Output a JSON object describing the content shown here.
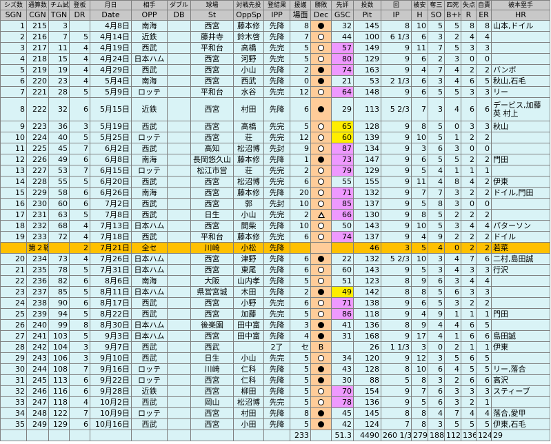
{
  "header1": [
    "シズ数",
    "通算数",
    "チム試",
    "登板",
    "月日",
    "相手",
    "ダブル",
    "球場",
    "対戦先投",
    "登結果",
    "援護",
    "勝敗",
    "先評",
    "投数",
    "回",
    "被安",
    "奪三",
    "四死",
    "失点",
    "自責",
    "被本塁手"
  ],
  "header2": [
    "SGN",
    "CGN",
    "TGN",
    "DR",
    "Date",
    "OPP",
    "DB",
    "St",
    "OppSp",
    "IPP",
    "場面",
    "Dec",
    "GSC",
    "Pit",
    "IP",
    "H",
    "SO",
    "B+H",
    "R",
    "ER",
    "HR"
  ],
  "rows": [
    {
      "sgn": "1",
      "cgn": "215",
      "tgn": "3",
      "dr": "",
      "date": "4月8日",
      "opp": "南海",
      "db": "",
      "st": "西宮",
      "sp": "藤本修",
      "ipp": "先降",
      "sc": "8",
      "dec": "win",
      "gsc": "32",
      "gc": "",
      "pit": "145",
      "ip": "8",
      "h": "10",
      "so": "5",
      "bh": "5",
      "r": "8",
      "er": "8",
      "hr": "山本,ドイル"
    },
    {
      "sgn": "2",
      "cgn": "216",
      "tgn": "7",
      "dr": "5",
      "date": "4月14日",
      "opp": "近鉄",
      "db": "",
      "st": "藤井寺",
      "sp": "鈴木啓",
      "ipp": "先降",
      "sc": "7",
      "dec": "loss",
      "gsc": "44",
      "gc": "",
      "pit": "100",
      "ip": "6 1/3",
      "h": "6",
      "so": "3",
      "bh": "2",
      "r": "4",
      "er": "4",
      "hr": ""
    },
    {
      "sgn": "3",
      "cgn": "217",
      "tgn": "11",
      "dr": "4",
      "date": "4月19日",
      "opp": "西武",
      "db": "",
      "st": "平和台",
      "sp": "高橋",
      "ipp": "先完",
      "sc": "5",
      "dec": "loss",
      "gsc": "57",
      "gc": "pink",
      "pit": "149",
      "ip": "9",
      "h": "11",
      "so": "7",
      "bh": "5",
      "r": "3",
      "er": "3",
      "hr": ""
    },
    {
      "sgn": "4",
      "cgn": "218",
      "tgn": "15",
      "dr": "4",
      "date": "4月24日",
      "opp": "日本ハム",
      "db": "",
      "st": "西宮",
      "sp": "河野",
      "ipp": "先完",
      "sc": "5",
      "dec": "loss",
      "gsc": "80",
      "gc": "pink",
      "pit": "129",
      "ip": "9",
      "h": "6",
      "so": "2",
      "bh": "3",
      "r": "0",
      "er": "0",
      "hr": ""
    },
    {
      "sgn": "5",
      "cgn": "219",
      "tgn": "19",
      "dr": "4",
      "date": "4月29日",
      "opp": "西武",
      "db": "",
      "st": "西宮",
      "sp": "小山",
      "ipp": "先降",
      "sc": "2",
      "dec": "win",
      "gsc": "74",
      "gc": "pink",
      "pit": "163",
      "ip": "9",
      "h": "4",
      "so": "7",
      "bh": "4",
      "r": "2",
      "er": "2",
      "hr": "バンボ"
    },
    {
      "sgn": "6",
      "cgn": "220",
      "tgn": "23",
      "dr": "4",
      "date": "5月4日",
      "opp": "南海",
      "db": "",
      "st": "西宮",
      "sp": "西武",
      "ipp": "先降",
      "sc": "0",
      "dec": "win",
      "gsc": "21",
      "gc": "",
      "pit": "53",
      "ip": "2 1/3",
      "h": "6",
      "so": "3",
      "bh": "4",
      "r": "6",
      "er": "5",
      "hr": "秋山,石毛"
    },
    {
      "sgn": "7",
      "cgn": "221",
      "tgn": "28",
      "dr": "5",
      "date": "5月9日",
      "opp": "ロッテ",
      "db": "",
      "st": "平和台",
      "sp": "水谷",
      "ipp": "先完",
      "sc": "12",
      "dec": "loss",
      "gsc": "64",
      "gc": "pink",
      "pit": "148",
      "ip": "9",
      "h": "6",
      "so": "5",
      "bh": "5",
      "r": "3",
      "er": "3",
      "hr": "リー"
    },
    {
      "sgn": "8",
      "cgn": "222",
      "tgn": "32",
      "dr": "6",
      "date": "5月15日",
      "opp": "近鉄",
      "db": "",
      "st": "西宮",
      "sp": "村田",
      "ipp": "先降",
      "sc": "6",
      "dec": "win",
      "gsc": "29",
      "gc": "",
      "pit": "113",
      "ip": "5 2/3",
      "h": "7",
      "so": "3",
      "bh": "4",
      "r": "6",
      "er": "6",
      "hr": "デービス,加藤英 村上",
      "tall": true
    },
    {
      "sgn": "9",
      "cgn": "223",
      "tgn": "36",
      "dr": "3",
      "date": "5月19日",
      "opp": "西武",
      "db": "",
      "st": "西宮",
      "sp": "高橋",
      "ipp": "先完",
      "sc": "5",
      "dec": "loss",
      "gsc": "65",
      "gc": "yel",
      "pit": "128",
      "ip": "9",
      "h": "8",
      "so": "5",
      "bh": "0",
      "r": "3",
      "er": "3",
      "hr": "秋山"
    },
    {
      "sgn": "10",
      "cgn": "224",
      "tgn": "40",
      "dr": "5",
      "date": "5月25日",
      "opp": "ロッテ",
      "db": "",
      "st": "西宮",
      "sp": "荘",
      "ipp": "先完",
      "sc": "12",
      "dec": "loss",
      "gsc": "60",
      "gc": "yel",
      "pit": "139",
      "ip": "9",
      "h": "10",
      "so": "5",
      "bh": "1",
      "r": "2",
      "er": "2",
      "hr": ""
    },
    {
      "sgn": "11",
      "cgn": "225",
      "tgn": "45",
      "dr": "7",
      "date": "6月2日",
      "opp": "西武",
      "db": "",
      "st": "高知",
      "sp": "松沼博",
      "ipp": "先封",
      "sc": "9",
      "dec": "loss",
      "gsc": "87",
      "gc": "pink",
      "pit": "134",
      "ip": "9",
      "h": "3",
      "so": "6",
      "bh": "3",
      "r": "0",
      "er": "0",
      "hr": ""
    },
    {
      "sgn": "12",
      "cgn": "226",
      "tgn": "49",
      "dr": "6",
      "date": "6月8日",
      "opp": "南海",
      "db": "",
      "st": "長岡悠久山",
      "sp": "藤本修",
      "ipp": "先降",
      "sc": "1",
      "dec": "win",
      "gsc": "73",
      "gc": "pink",
      "pit": "147",
      "ip": "9",
      "h": "6",
      "so": "5",
      "bh": "5",
      "r": "2",
      "er": "2",
      "hr": "門田"
    },
    {
      "sgn": "13",
      "cgn": "227",
      "tgn": "53",
      "dr": "7",
      "date": "6月15日",
      "opp": "ロッテ",
      "db": "",
      "st": "松江市営",
      "sp": "荘",
      "ipp": "先完",
      "sc": "2",
      "dec": "loss",
      "gsc": "79",
      "gc": "pink",
      "pit": "129",
      "ip": "9",
      "h": "5",
      "so": "4",
      "bh": "1",
      "r": "1",
      "er": "1",
      "hr": ""
    },
    {
      "sgn": "14",
      "cgn": "228",
      "tgn": "55",
      "dr": "5",
      "date": "6月20日",
      "opp": "西武",
      "db": "",
      "st": "西宮",
      "sp": "松沼博",
      "ipp": "先完",
      "sc": "6",
      "dec": "loss",
      "gsc": "55",
      "gc": "",
      "pit": "155",
      "ip": "9",
      "h": "11",
      "so": "4",
      "bh": "8",
      "r": "4",
      "er": "2",
      "hr": "伊東"
    },
    {
      "sgn": "15",
      "cgn": "229",
      "tgn": "58",
      "dr": "6",
      "date": "6月26日",
      "opp": "南海",
      "db": "",
      "st": "西宮",
      "sp": "藤本修",
      "ipp": "先降",
      "sc": "20",
      "dec": "loss",
      "gsc": "71",
      "gc": "pink",
      "pit": "132",
      "ip": "9",
      "h": "7",
      "so": "7",
      "bh": "3",
      "r": "2",
      "er": "2",
      "hr": "ドイル,門田"
    },
    {
      "sgn": "16",
      "cgn": "230",
      "tgn": "60",
      "dr": "6",
      "date": "7月2日",
      "opp": "西武",
      "db": "",
      "st": "西宮",
      "sp": "郭",
      "ipp": "先封",
      "sc": "10",
      "dec": "loss",
      "gsc": "85",
      "gc": "pink",
      "pit": "137",
      "ip": "9",
      "h": "5",
      "so": "8",
      "bh": "3",
      "r": "0",
      "er": "0",
      "hr": ""
    },
    {
      "sgn": "17",
      "cgn": "231",
      "tgn": "63",
      "dr": "5",
      "date": "7月8日",
      "opp": "西武",
      "db": "",
      "st": "日生",
      "sp": "小山",
      "ipp": "先完",
      "sc": "2",
      "dec": "nd",
      "gsc": "66",
      "gc": "pink",
      "pit": "130",
      "ip": "9",
      "h": "8",
      "so": "5",
      "bh": "2",
      "r": "2",
      "er": "2",
      "hr": ""
    },
    {
      "sgn": "18",
      "cgn": "232",
      "tgn": "68",
      "dr": "4",
      "date": "7月13日",
      "opp": "日本ハム",
      "db": "",
      "st": "西宮",
      "sp": "間柴",
      "ipp": "先降",
      "sc": "10",
      "dec": "loss",
      "gsc": "50",
      "gc": "",
      "pit": "143",
      "ip": "9",
      "h": "10",
      "so": "5",
      "bh": "3",
      "r": "4",
      "er": "4",
      "hr": "パターソン"
    },
    {
      "sgn": "19",
      "cgn": "233",
      "tgn": "72",
      "dr": "4",
      "date": "7月18日",
      "opp": "西武",
      "db": "",
      "st": "平和台",
      "sp": "藤本修",
      "ipp": "先完",
      "sc": "6",
      "dec": "loss",
      "gsc": "74",
      "gc": "pink",
      "pit": "137",
      "ip": "9",
      "h": "4",
      "so": "9",
      "bh": "2",
      "r": "2",
      "er": "2",
      "hr": "ドイル"
    },
    {
      "sgn": "",
      "cgn": "第２戦",
      "tgn": "",
      "dr": "2",
      "date": "7月21日",
      "opp": "全セ",
      "db": "",
      "st": "川崎",
      "sp": "小松",
      "ipp": "先降",
      "sc": "",
      "dec": "",
      "gsc": "",
      "gc": "",
      "pit": "46",
      "ip": "3",
      "h": "5",
      "so": "4",
      "bh": "0",
      "r": "2",
      "er": "2",
      "hr": "若菜",
      "allstar": true
    },
    {
      "sgn": "20",
      "cgn": "234",
      "tgn": "73",
      "dr": "4",
      "date": "7月26日",
      "opp": "日本ハム",
      "db": "",
      "st": "西宮",
      "sp": "津野",
      "ipp": "先降",
      "sc": "6",
      "dec": "win",
      "gsc": "22",
      "gc": "",
      "pit": "132",
      "ip": "5 2/3",
      "h": "10",
      "so": "3",
      "bh": "4",
      "r": "7",
      "er": "6",
      "hr": "二村,島田誠"
    },
    {
      "sgn": "21",
      "cgn": "235",
      "tgn": "78",
      "dr": "5",
      "date": "7月31日",
      "opp": "日本ハム",
      "db": "",
      "st": "西宮",
      "sp": "東尾",
      "ipp": "先降",
      "sc": "6",
      "dec": "loss",
      "gsc": "60",
      "gc": "",
      "pit": "143",
      "ip": "9",
      "h": "5",
      "so": "3",
      "bh": "4",
      "r": "3",
      "er": "3",
      "hr": "行沢"
    },
    {
      "sgn": "22",
      "cgn": "236",
      "tgn": "82",
      "dr": "6",
      "date": "8月6日",
      "opp": "南海",
      "db": "",
      "st": "大阪",
      "sp": "山内孝",
      "ipp": "先降",
      "sc": "5",
      "dec": "loss",
      "gsc": "51",
      "gc": "",
      "pit": "123",
      "ip": "8",
      "h": "9",
      "so": "6",
      "bh": "3",
      "r": "4",
      "er": "4",
      "hr": ""
    },
    {
      "sgn": "23",
      "cgn": "237",
      "tgn": "85",
      "dr": "5",
      "date": "8月11日",
      "opp": "日本ハム",
      "db": "",
      "st": "県営宮城",
      "sp": "木田",
      "ipp": "先降",
      "sc": "2",
      "dec": "win",
      "gsc": "49",
      "gc": "yel",
      "pit": "142",
      "ip": "8",
      "h": "8",
      "so": "5",
      "bh": "6",
      "r": "3",
      "er": "3",
      "hr": ""
    },
    {
      "sgn": "24",
      "cgn": "238",
      "tgn": "90",
      "dr": "6",
      "date": "8月17日",
      "opp": "西武",
      "db": "",
      "st": "西宮",
      "sp": "小野",
      "ipp": "先完",
      "sc": "6",
      "dec": "loss",
      "gsc": "71",
      "gc": "pink",
      "pit": "138",
      "ip": "9",
      "h": "6",
      "so": "5",
      "bh": "3",
      "r": "2",
      "er": "2",
      "hr": ""
    },
    {
      "sgn": "25",
      "cgn": "239",
      "tgn": "94",
      "dr": "5",
      "date": "8月22日",
      "opp": "西武",
      "db": "",
      "st": "西宮",
      "sp": "加藤",
      "ipp": "先完",
      "sc": "5",
      "dec": "loss",
      "gsc": "86",
      "gc": "pink",
      "pit": "118",
      "ip": "9",
      "h": "4",
      "so": "9",
      "bh": "1",
      "r": "1",
      "er": "1",
      "hr": "門田"
    },
    {
      "sgn": "26",
      "cgn": "240",
      "tgn": "99",
      "dr": "8",
      "date": "8月30日",
      "opp": "日本ハム",
      "db": "",
      "st": "後楽園",
      "sp": "田中富",
      "ipp": "先降",
      "sc": "3",
      "dec": "win",
      "gsc": "41",
      "gc": "",
      "pit": "136",
      "ip": "8",
      "h": "9",
      "so": "4",
      "bh": "4",
      "r": "6",
      "er": "5",
      "hr": ""
    },
    {
      "sgn": "27",
      "cgn": "241",
      "tgn": "103",
      "dr": "5",
      "date": "9月3日",
      "opp": "日本ハム",
      "db": "",
      "st": "西宮",
      "sp": "田中富",
      "ipp": "先降",
      "sc": "4",
      "dec": "win",
      "gsc": "31",
      "gc": "",
      "pit": "168",
      "ip": "9",
      "h": "17",
      "so": "4",
      "bh": "1",
      "r": "6",
      "er": "6",
      "hr": "島田誠"
    },
    {
      "sgn": "28",
      "cgn": "242",
      "tgn": "104",
      "dr": "3",
      "date": "9月7日",
      "opp": "西武",
      "db": "",
      "st": "西武",
      "sp": "",
      "ipp": "2了",
      "sc": "セ",
      "dec": "B",
      "gsc": "",
      "gc": "",
      "pit": "26",
      "ip": "1 1/3",
      "h": "3",
      "so": "0",
      "bh": "2",
      "r": "1",
      "er": "1",
      "hr": "伊東",
      "relief": true
    },
    {
      "sgn": "29",
      "cgn": "243",
      "tgn": "106",
      "dr": "3",
      "date": "9月10日",
      "opp": "西武",
      "db": "",
      "st": "日生",
      "sp": "小山",
      "ipp": "先完",
      "sc": "5",
      "dec": "loss",
      "gsc": "34",
      "gc": "",
      "pit": "120",
      "ip": "9",
      "h": "12",
      "so": "3",
      "bh": "5",
      "r": "6",
      "er": "5",
      "hr": ""
    },
    {
      "sgn": "30",
      "cgn": "244",
      "tgn": "108",
      "dr": "7",
      "date": "9月16日",
      "opp": "ロッテ",
      "db": "",
      "st": "川崎",
      "sp": "仁科",
      "ipp": "先降",
      "sc": "5",
      "dec": "win",
      "gsc": "43",
      "gc": "",
      "pit": "128",
      "ip": "8",
      "h": "10",
      "so": "6",
      "bh": "4",
      "r": "5",
      "er": "5",
      "hr": "リー,落合"
    },
    {
      "sgn": "31",
      "cgn": "245",
      "tgn": "113",
      "dr": "6",
      "date": "9月22日",
      "opp": "ロッテ",
      "db": "",
      "st": "西宮",
      "sp": "仁科",
      "ipp": "先降",
      "sc": "5",
      "dec": "win",
      "gsc": "30",
      "gc": "",
      "pit": "88",
      "ip": "5",
      "h": "8",
      "so": "3",
      "bh": "2",
      "r": "6",
      "er": "6",
      "hr": "高沢"
    },
    {
      "sgn": "32",
      "cgn": "246",
      "tgn": "116",
      "dr": "6",
      "date": "9月28日",
      "opp": "近鉄",
      "db": "",
      "st": "西宮",
      "sp": "柳田",
      "ipp": "先降",
      "sc": "5",
      "dec": "loss",
      "gsc": "70",
      "gc": "pink",
      "pit": "154",
      "ip": "9",
      "h": "7",
      "so": "6",
      "bh": "3",
      "r": "3",
      "er": "3",
      "hr": "スティーブ"
    },
    {
      "sgn": "33",
      "cgn": "247",
      "tgn": "118",
      "dr": "4",
      "date": "10月2日",
      "opp": "西武",
      "db": "",
      "st": "岡山",
      "sp": "松沼博",
      "ipp": "先完",
      "sc": "5",
      "dec": "loss",
      "gsc": "78",
      "gc": "pink",
      "pit": "136",
      "ip": "9",
      "h": "5",
      "so": "6",
      "bh": "3",
      "r": "2",
      "er": "1",
      "hr": ""
    },
    {
      "sgn": "34",
      "cgn": "248",
      "tgn": "122",
      "dr": "7",
      "date": "10月9日",
      "opp": "ロッテ",
      "db": "",
      "st": "西宮",
      "sp": "村田",
      "ipp": "先降",
      "sc": "8",
      "dec": "win",
      "gsc": "45",
      "gc": "",
      "pit": "145",
      "ip": "8",
      "h": "8",
      "so": "4",
      "bh": "7",
      "r": "4",
      "er": "4",
      "hr": "落合,愛甲"
    },
    {
      "sgn": "35",
      "cgn": "249",
      "tgn": "129",
      "dr": "6",
      "date": "10月16日",
      "opp": "西武",
      "db": "",
      "st": "西宮",
      "sp": "小田",
      "ipp": "先降",
      "sc": "5",
      "dec": "win",
      "gsc": "42",
      "gc": "",
      "pit": "124",
      "ip": "7",
      "h": "8",
      "so": "3",
      "bh": "5",
      "r": "5",
      "er": "5",
      "hr": "伊東,石毛"
    }
  ],
  "totals": {
    "sc": "233",
    "gsc": "51.3",
    "pit": "4490",
    "ip": "260 1/3",
    "h": "279",
    "so": "188",
    "bh": "112",
    "r": "136",
    "er": "124",
    "hr": "29"
  },
  "colors": {
    "row_bg": "#d9f3f6",
    "header_bg": "#c8c8c8",
    "allstar_bg": "#ffc000",
    "dec_bg": "#ffcc99",
    "gsc_pink": "#ee99ff",
    "gsc_yellow": "#ffee00",
    "cgn": "#e0001b",
    "tgn": "#1f3cff"
  },
  "icons": {
    "win": "filled-circle-icon",
    "loss": "open-circle-icon",
    "no_decision": "triangle-icon"
  }
}
